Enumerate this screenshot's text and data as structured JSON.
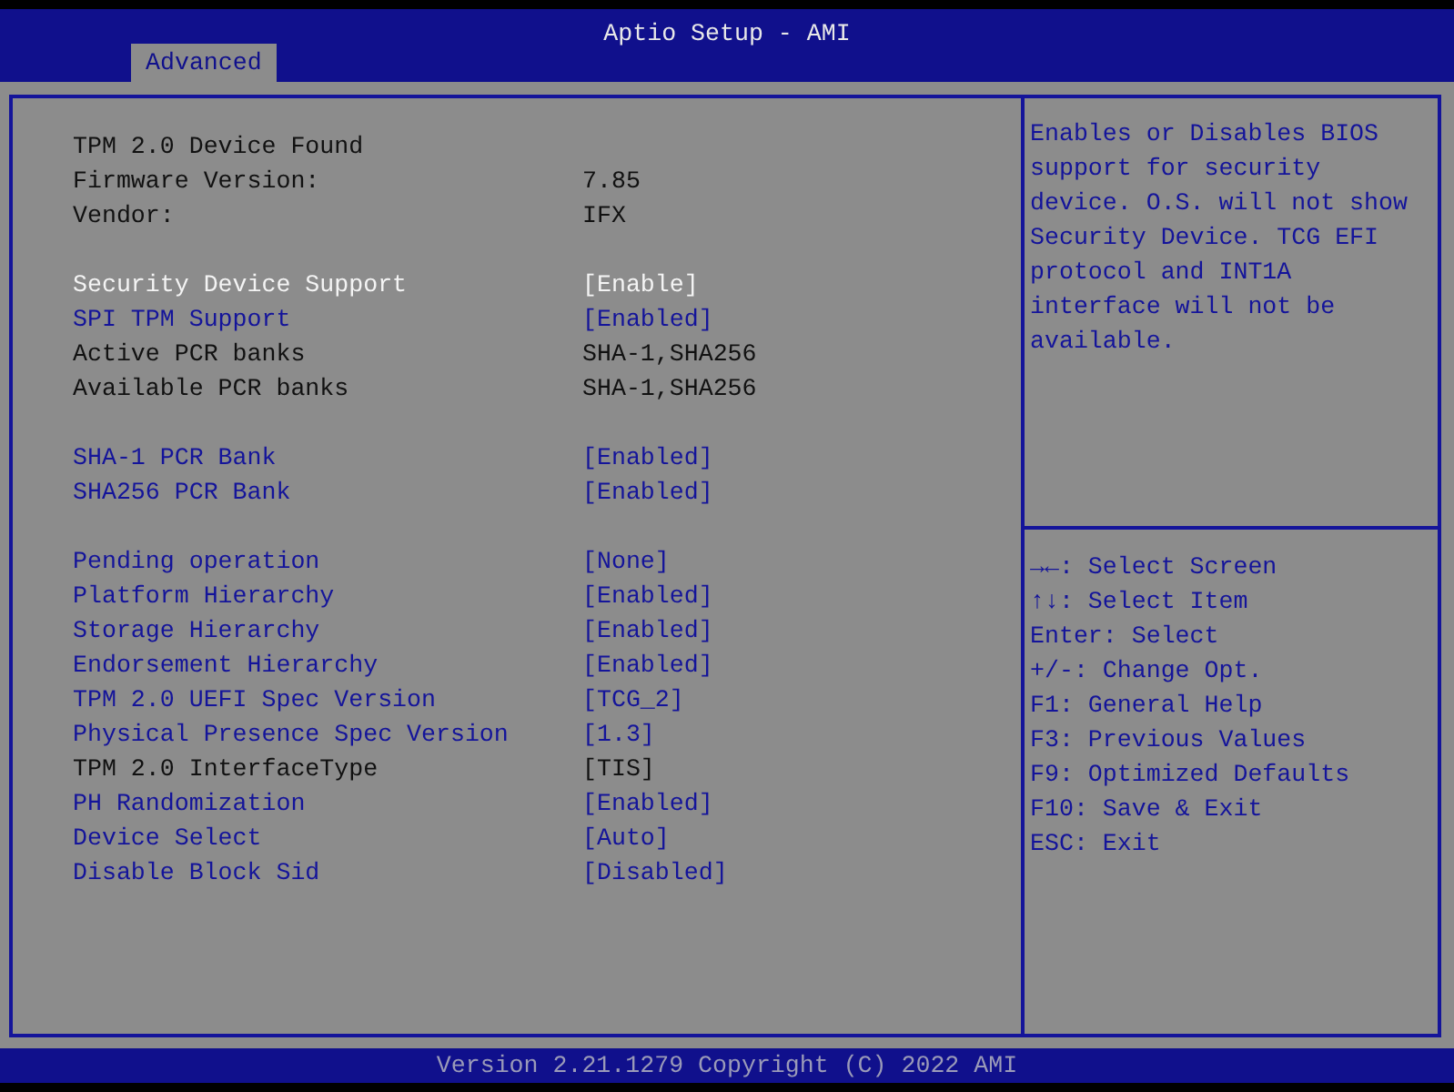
{
  "header": {
    "title": "Aptio Setup - AMI"
  },
  "tabs": [
    {
      "label": "Advanced",
      "selected": true
    }
  ],
  "items": [
    {
      "kind": "info",
      "label": "TPM 2.0 Device Found"
    },
    {
      "kind": "info",
      "label": "Firmware Version:",
      "value": "7.85"
    },
    {
      "kind": "info",
      "label": "Vendor:",
      "value": "IFX"
    },
    {
      "kind": "gap"
    },
    {
      "kind": "option",
      "label": "Security Device Support",
      "value": "[Enable]",
      "selected": true
    },
    {
      "kind": "option",
      "label": "SPI TPM Support",
      "value": "[Enabled]",
      "selected": false
    },
    {
      "kind": "info",
      "label": "Active PCR banks",
      "value": "SHA-1,SHA256"
    },
    {
      "kind": "info",
      "label": "Available PCR banks",
      "value": "SHA-1,SHA256"
    },
    {
      "kind": "gap"
    },
    {
      "kind": "option",
      "label": "SHA-1 PCR Bank",
      "value": "[Enabled]",
      "selected": false
    },
    {
      "kind": "option",
      "label": "SHA256 PCR Bank",
      "value": "[Enabled]",
      "selected": false
    },
    {
      "kind": "gap"
    },
    {
      "kind": "option",
      "label": "Pending operation",
      "value": "[None]",
      "selected": false
    },
    {
      "kind": "option",
      "label": "Platform Hierarchy",
      "value": "[Enabled]",
      "selected": false
    },
    {
      "kind": "option",
      "label": "Storage Hierarchy",
      "value": "[Enabled]",
      "selected": false
    },
    {
      "kind": "option",
      "label": "Endorsement Hierarchy",
      "value": "[Enabled]",
      "selected": false
    },
    {
      "kind": "option",
      "label": "TPM 2.0 UEFI Spec Version",
      "value": "[TCG_2]",
      "selected": false
    },
    {
      "kind": "option",
      "label": "Physical Presence Spec Version",
      "value": "[1.3]",
      "selected": false
    },
    {
      "kind": "info",
      "label": "TPM 2.0 InterfaceType",
      "value": "[TIS]"
    },
    {
      "kind": "option",
      "label": "PH Randomization",
      "value": "[Enabled]",
      "selected": false
    },
    {
      "kind": "option",
      "label": "Device Select",
      "value": "[Auto]",
      "selected": false
    },
    {
      "kind": "option",
      "label": "Disable Block Sid",
      "value": "[Disabled]",
      "selected": false
    }
  ],
  "help": {
    "text": "Enables or Disables BIOS support for security device. O.S. will not show Security Device. TCG EFI protocol and INT1A interface will not be available."
  },
  "key_hints": [
    {
      "key": "→←",
      "action": ": Select Screen"
    },
    {
      "key": "↑↓",
      "action": ": Select Item"
    },
    {
      "key": "Enter",
      "action": ": Select"
    },
    {
      "key": "+/-",
      "action": ": Change Opt."
    },
    {
      "key": "F1",
      "action": ": General Help"
    },
    {
      "key": "F3",
      "action": ": Previous Values"
    },
    {
      "key": "F9",
      "action": ": Optimized Defaults"
    },
    {
      "key": "F10",
      "action": ": Save & Exit"
    },
    {
      "key": "ESC",
      "action": ": Exit"
    }
  ],
  "footer": {
    "text": "Version 2.21.1279 Copyright (C) 2022 AMI"
  }
}
